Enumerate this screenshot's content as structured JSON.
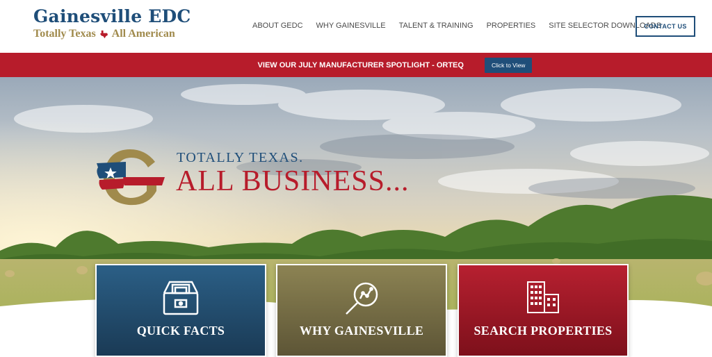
{
  "header": {
    "logo_title": "Gainesville EDC",
    "logo_tagline_left": "Totally Texas",
    "logo_tagline_right": "All American",
    "nav": [
      {
        "label": "ABOUT GEDC"
      },
      {
        "label": "WHY GAINESVILLE"
      },
      {
        "label": "TALENT & TRAINING"
      },
      {
        "label": "PROPERTIES"
      },
      {
        "label": "SITE SELECTOR DOWNLOADS"
      }
    ],
    "contact_label": "CONTACT US"
  },
  "banner": {
    "text": "VIEW OUR JULY MANUFACTURER SPOTLIGHT - ORTEQ",
    "button_label": "Click to View"
  },
  "hero": {
    "tagline_line1": "TOTALLY TEXAS.",
    "tagline_line2": "ALL BUSINESS..."
  },
  "cards": [
    {
      "label": "QUICK FACTS",
      "icon": "file-cabinet-icon"
    },
    {
      "label": "WHY GAINESVILLE",
      "icon": "magnifier-chart-icon"
    },
    {
      "label": "SEARCH PROPERTIES",
      "icon": "buildings-icon"
    }
  ],
  "colors": {
    "navy": "#1f4e79",
    "red": "#b71c2b",
    "gold": "#a08a4c"
  }
}
